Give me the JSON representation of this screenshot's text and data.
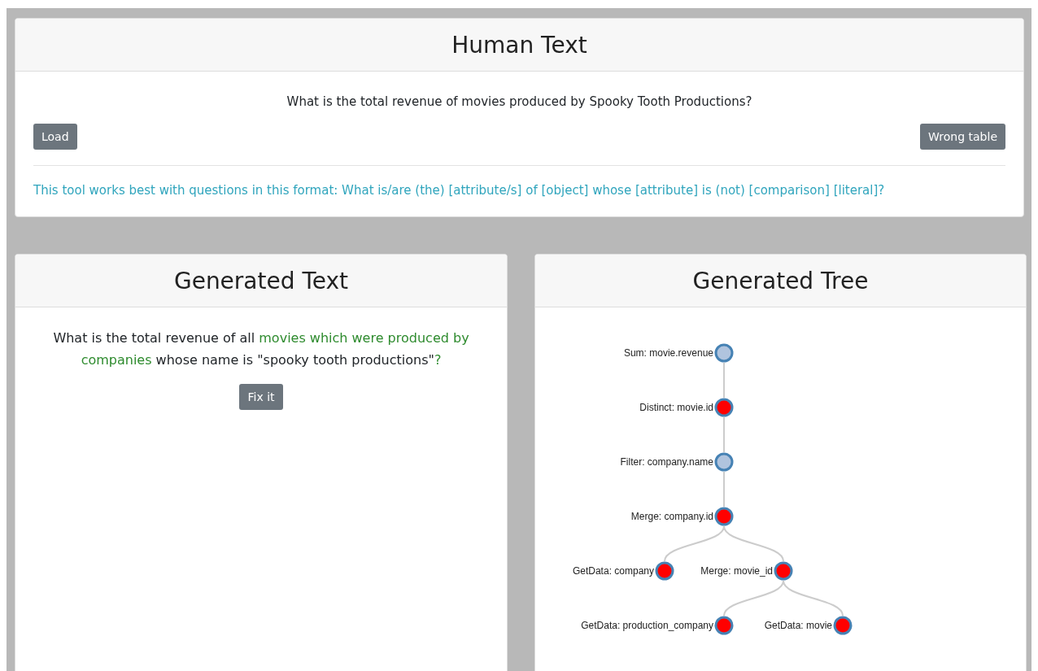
{
  "human_text": {
    "title": "Human Text",
    "question": "What is the total revenue of movies produced by Spooky Tooth Productions?",
    "buttons": [
      "Load",
      "Wrong table"
    ],
    "hint": "This tool works best with questions in this format: What is/are (the) [attribute/s] of [object] whose [attribute] is (not) [comparison] [literal]?"
  },
  "generated_text": {
    "title": "Generated Text",
    "segments": [
      {
        "text": "What is the total revenue of all ",
        "highlight": false
      },
      {
        "text": "movies which were produced by companies",
        "highlight": true
      },
      {
        "text": " whose name is \"spooky tooth productions\"",
        "highlight": false
      },
      {
        "text": "?",
        "highlight": true
      }
    ],
    "button": "Fix it"
  },
  "generated_tree": {
    "title": "Generated Tree",
    "root": {
      "label": "Sum: movie.revenue",
      "flagged": false,
      "children": [
        {
          "label": "Distinct: movie.id",
          "flagged": true,
          "children": [
            {
              "label": "Filter: company.name",
              "flagged": false,
              "children": [
                {
                  "label": "Merge: company.id",
                  "flagged": true,
                  "children": [
                    {
                      "label": "GetData: company",
                      "flagged": true
                    },
                    {
                      "label": "Merge: movie_id",
                      "flagged": true,
                      "children": [
                        {
                          "label": "GetData: production_company",
                          "flagged": true
                        },
                        {
                          "label": "GetData: movie",
                          "flagged": true
                        }
                      ]
                    }
                  ]
                }
              ]
            }
          ]
        }
      ]
    }
  }
}
